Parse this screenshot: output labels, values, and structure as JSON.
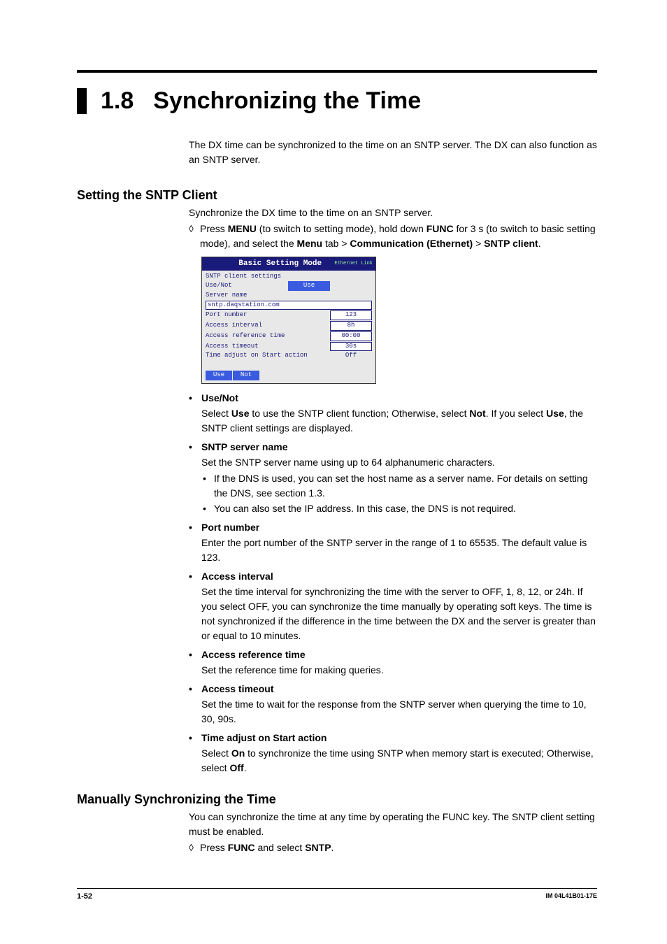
{
  "header": {
    "number": "1.8",
    "title": "Synchronizing the Time"
  },
  "intro": "The DX time can be synchronized to the time on an SNTP server.  The DX can also function as an SNTP server.",
  "s1": {
    "heading": "Setting the SNTP Client",
    "lead": "Synchronize the DX time to the time on an SNTP server.",
    "proc_a": "Press ",
    "proc_menu": "MENU",
    "proc_b": " (to switch to setting mode), hold down ",
    "proc_func": "FUNC",
    "proc_c": " for 3 s (to switch to basic setting mode), and select the ",
    "proc_menutab": "Menu",
    "proc_d": " tab > ",
    "proc_comm": "Communication (Ethernet)",
    "proc_e": " > ",
    "proc_sntp": "SNTP client",
    "proc_f": "."
  },
  "shot": {
    "title": "Basic Setting Mode",
    "eth": "Ethernet\nLink",
    "heading": "SNTP client settings",
    "rows": {
      "use": {
        "lbl": "Use/Not",
        "val": "Use"
      },
      "sname": {
        "lbl": "Server name"
      },
      "host": "sntp.daqstation.com",
      "port": {
        "lbl": "Port number",
        "val": "123"
      },
      "intv": {
        "lbl": "Access interval",
        "val": "8h"
      },
      "ref": {
        "lbl": "Access reference time",
        "val": "00:00"
      },
      "tout": {
        "lbl": "Access timeout",
        "val": "30s"
      },
      "adj": {
        "lbl": "Time adjust on Start action",
        "val": "Off"
      }
    },
    "opts": {
      "use": "Use",
      "not": "Not"
    }
  },
  "opts": {
    "use": {
      "title": "Use/Not",
      "b1": "Select ",
      "k1": "Use",
      "b2": " to use the SNTP client function; Otherwise, select ",
      "k2": "Not",
      "b3": ".  If you select ",
      "k3": "Use",
      "b4": ", the SNTP client settings are displayed."
    },
    "sname": {
      "title": "SNTP server name",
      "body": "Set the SNTP server name using up to 64 alphanumeric characters.",
      "i1": "If the DNS is used, you can set the host name as a server name.  For details on setting the DNS, see section 1.3.",
      "i2": "You can also set the IP address.  In this case, the DNS is not required."
    },
    "port": {
      "title": "Port number",
      "body": "Enter the port number of the SNTP server in the range of 1 to 65535.  The default value is 123."
    },
    "intv": {
      "title": "Access interval",
      "body": "Set the time interval for synchronizing the time with the server to OFF, 1, 8, 12, or 24h.  If you select OFF, you can synchronize the time manually by operating soft keys.  The time is not synchronized if the difference in the time between the DX and the server is greater than or equal to 10 minutes."
    },
    "ref": {
      "title": "Access reference time",
      "body": "Set the reference time for making queries."
    },
    "tout": {
      "title": "Access timeout",
      "body": "Set the time to wait for the response from the SNTP server when querying the time to 10, 30, 90s."
    },
    "adj": {
      "title": "Time adjust on Start action",
      "b1": "Select ",
      "k1": "On",
      "b2": " to synchronize the time using SNTP when memory start is executed; Otherwise, select ",
      "k2": "Off",
      "b3": "."
    }
  },
  "s2": {
    "heading": "Manually Synchronizing the Time",
    "lead": "You can synchronize the time at any time by operating the FUNC key.  The SNTP client setting must be enabled.",
    "p1": "Press ",
    "k1": "FUNC",
    "p2": " and select ",
    "k2": "SNTP",
    "p3": "."
  },
  "footer": {
    "page": "1-52",
    "doc": "IM 04L41B01-17E"
  }
}
